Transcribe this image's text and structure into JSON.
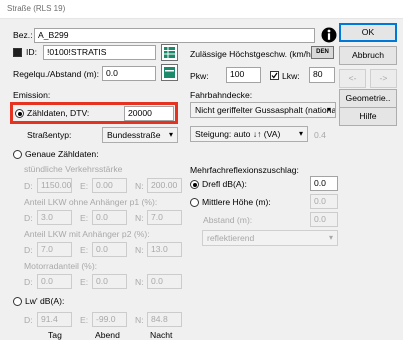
{
  "window": {
    "title": "Straße (RLS 19)"
  },
  "buttons": {
    "ok": "OK",
    "cancel": "Abbruch",
    "back": "<-",
    "forward": "->",
    "geometry": "Geometrie..",
    "help": "Hilfe"
  },
  "left": {
    "bez_label": "Bez.:",
    "bez_value": "A_B299",
    "id_label": "ID:",
    "id_value": "!0100!STRATIS",
    "regelqu_label": "Regelqu./Abstand (m):",
    "regelqu_value": "0.0",
    "emission_label": "Emission:",
    "zaehldaten_label": "Zähldaten, DTV:",
    "zaehldaten_value": "20000",
    "strassentyp_label": "Straßentyp:",
    "strassentyp_value": "Bundesstraße",
    "genaue_label": "Genaue Zähldaten:",
    "verkehrsstaerke_label": "stündliche Verkehrsstärke",
    "row1": {
      "d_label": "D:",
      "d": "1150.00",
      "e_label": "E:",
      "e": "0.00",
      "n_label": "N:",
      "n": "200.00"
    },
    "lkw1_label": "Anteil LKW ohne Anhänger p1 (%):",
    "row2": {
      "d_label": "D:",
      "d": "3.0",
      "e_label": "E:",
      "e": "0.0",
      "n_label": "N:",
      "n": "7.0"
    },
    "lkw2_label": "Anteil LKW mit Anhänger p2 (%):",
    "row3": {
      "d_label": "D:",
      "d": "7.0",
      "e_label": "E:",
      "e": "0.0",
      "n_label": "N:",
      "n": "13.0"
    },
    "motorrad_label": "Motorradanteil (%):",
    "row4": {
      "d_label": "D:",
      "d": "0.0",
      "e_label": "E:",
      "e": "0.0",
      "n_label": "N:",
      "n": "0.0"
    },
    "lw_label": "Lw' dB(A):",
    "row5": {
      "d_label": "D:",
      "d": "91.4",
      "e_label": "E:",
      "e": "-99.0",
      "n_label": "N:",
      "n": "84.8"
    },
    "col_tag": "Tag",
    "col_abend": "Abend",
    "col_nacht": "Nacht"
  },
  "right": {
    "hoechst_label": "Zulässige Höchstgeschw. (km/h):",
    "den_label": "DEN",
    "pkw_label": "Pkw:",
    "pkw_value": "100",
    "lkw_label": "Lkw:",
    "lkw_value": "80",
    "fahrbahn_label": "Fahrbahndecke:",
    "fahrbahn_value": "Nicht geriffelter Gussasphalt (nationa",
    "steigung_value": "Steigung: auto ↓↑ (VA)",
    "steigung_pct": "0.4",
    "mehrfach_label": "Mehrfachreflexionszuschlag:",
    "drefl_label": "Drefl dB(A):",
    "drefl_value": "0.0",
    "hoehe_label": "Mittlere Höhe (m):",
    "hoehe_value": "0.0",
    "abstand_label": "Abstand (m):",
    "abstand_value": "0.0",
    "reflekt_value": "reflektierend"
  },
  "icons": {
    "info": "info-icon",
    "table": "table-icon",
    "chart": "chart-icon",
    "dropdown": "▾"
  }
}
